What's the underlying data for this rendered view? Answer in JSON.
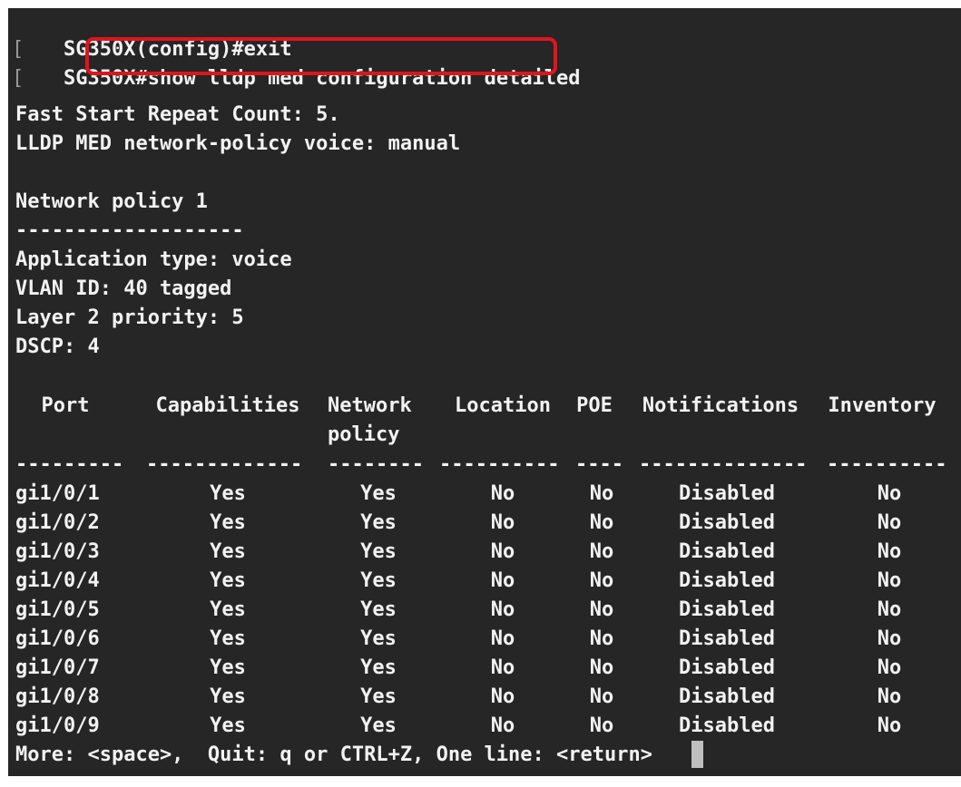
{
  "terminal": {
    "prev_prompt": "SG350X(config)#exit",
    "bracket": "[",
    "prompt": "SG350X",
    "command": "#show lldp med configuration detailed",
    "fast_start": "Fast Start Repeat Count: 5.",
    "policy_mode": "LLDP MED network-policy voice: manual",
    "policy_title": "Network policy 1",
    "policy_divider": "-------------------",
    "app_type": "Application type: voice",
    "vlan": "VLAN ID: 40 tagged",
    "l2_priority": "Layer 2 priority: 5",
    "dscp": "DSCP: 4",
    "more_prompt": "More: <space>,  Quit: q or CTRL+Z, One line: <return>"
  },
  "table": {
    "headers": {
      "port": "Port",
      "capabilities": "Capabilities",
      "network_1": "Network",
      "network_2": "policy",
      "location": "Location",
      "poe": "POE",
      "notifications": "Notifications",
      "inventory": "Inventory"
    },
    "dividers": {
      "port": "---------",
      "capabilities": "-------------",
      "network": "--------",
      "location": "----------",
      "poe": "----",
      "notifications": "--------------",
      "inventory": "----------"
    },
    "rows": [
      {
        "port": "gi1/0/1",
        "capabilities": "Yes",
        "network": "Yes",
        "location": "No",
        "poe": "No",
        "notifications": "Disabled",
        "inventory": "No"
      },
      {
        "port": "gi1/0/2",
        "capabilities": "Yes",
        "network": "Yes",
        "location": "No",
        "poe": "No",
        "notifications": "Disabled",
        "inventory": "No"
      },
      {
        "port": "gi1/0/3",
        "capabilities": "Yes",
        "network": "Yes",
        "location": "No",
        "poe": "No",
        "notifications": "Disabled",
        "inventory": "No"
      },
      {
        "port": "gi1/0/4",
        "capabilities": "Yes",
        "network": "Yes",
        "location": "No",
        "poe": "No",
        "notifications": "Disabled",
        "inventory": "No"
      },
      {
        "port": "gi1/0/5",
        "capabilities": "Yes",
        "network": "Yes",
        "location": "No",
        "poe": "No",
        "notifications": "Disabled",
        "inventory": "No"
      },
      {
        "port": "gi1/0/6",
        "capabilities": "Yes",
        "network": "Yes",
        "location": "No",
        "poe": "No",
        "notifications": "Disabled",
        "inventory": "No"
      },
      {
        "port": "gi1/0/7",
        "capabilities": "Yes",
        "network": "Yes",
        "location": "No",
        "poe": "No",
        "notifications": "Disabled",
        "inventory": "No"
      },
      {
        "port": "gi1/0/8",
        "capabilities": "Yes",
        "network": "Yes",
        "location": "No",
        "poe": "No",
        "notifications": "Disabled",
        "inventory": "No"
      },
      {
        "port": "gi1/0/9",
        "capabilities": "Yes",
        "network": "Yes",
        "location": "No",
        "poe": "No",
        "notifications": "Disabled",
        "inventory": "No"
      }
    ]
  },
  "colors": {
    "background": "#262626",
    "text": "#f2f2f2",
    "highlight_border": "#e0151b",
    "cursor": "#bfbfbf"
  }
}
